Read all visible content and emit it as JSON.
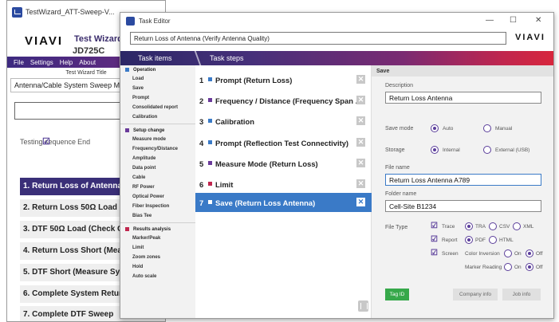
{
  "bg_window": {
    "title": "TestWizard_ATT-Sweep-V...",
    "minimize": "—",
    "brand_logo": "VIAVI",
    "app_title": "Test Wizard",
    "model": "JD725C",
    "menu": [
      "File",
      "Settings",
      "Help",
      "About"
    ],
    "wizard_title_label": "Test Wizard Title",
    "wizard_title_value": "Antenna/Cable System Sweep MOP",
    "sequence_header": "Testing sequence",
    "sequence_end_label": "End",
    "sequence": [
      "1. Return Loss of Antenna (...)",
      "2. Return Loss 50Ω Load (V...)",
      "3. DTF 50Ω Load (Check Ca...)",
      "4. Return Loss Short (Meas...)",
      "5. DTF Short (Measure Syst...)",
      "6. Complete System Return...",
      "7. Complete DTF Sweep"
    ]
  },
  "task_editor": {
    "title": "Task Editor",
    "window_controls": [
      "—",
      "☐",
      "✕"
    ],
    "task_name": "Return Loss of Antenna (Verify Antenna Quality)",
    "brand_logo": "VIAVI",
    "col_task_items": "Task items",
    "col_task_steps": "Task steps",
    "nav_groups": [
      {
        "label": "Operation",
        "color": "#3a7ac7",
        "items": [
          "Load",
          "Save",
          "Prompt",
          "Consolidated report",
          "Calibration"
        ]
      },
      {
        "label": "Setup change",
        "color": "#6a3a9a",
        "items": [
          "Measure mode",
          "Frequency/Distance",
          "Amplitude",
          "Data point",
          "Cable",
          "RF Power",
          "Optical Power",
          "Fiber Inspection",
          "Bias Tee"
        ]
      },
      {
        "label": "Results analysis",
        "color": "#c0264e",
        "items": [
          "Marker/Peak",
          "Limit",
          "Zoom zones",
          "Hold",
          "Auto scale"
        ]
      }
    ],
    "steps": [
      {
        "num": "1",
        "label": "Prompt (Return Loss)",
        "color": "#3a7ac7"
      },
      {
        "num": "2",
        "label": "Frequency / Distance (Frequency Span ...",
        "color": "#6a3a9a"
      },
      {
        "num": "3",
        "label": "Calibration",
        "color": "#3a7ac7"
      },
      {
        "num": "4",
        "label": "Prompt (Reflection Test Connectivity)",
        "color": "#3a7ac7"
      },
      {
        "num": "5",
        "label": "Measure Mode (Return Loss)",
        "color": "#6a3a9a"
      },
      {
        "num": "6",
        "label": "Limit",
        "color": "#c0264e"
      },
      {
        "num": "7",
        "label": "Save (Return Loss Antenna)",
        "color": "#ffffff"
      }
    ],
    "form": {
      "section": "Save",
      "description_label": "Description",
      "description_value": "Return Loss Antenna",
      "save_mode_label": "Save mode",
      "save_mode_auto": "Auto",
      "save_mode_manual": "Manual",
      "storage_label": "Storage",
      "storage_internal": "Internal",
      "storage_external": "External (USB)",
      "file_name_label": "File name",
      "file_name_value": "Return Loss Antenna A789",
      "folder_name_label": "Folder name",
      "folder_name_value": "Cell-Site B1234",
      "file_type_label": "File Type",
      "trace_label": "Trace",
      "tra": "TRA",
      "csv": "CSV",
      "xml": "XML",
      "report_label": "Report",
      "pdf": "PDF",
      "html": "HTML",
      "screen_label": "Screen",
      "color_inversion": "Color Inversion",
      "marker_reading": "Marker Reading",
      "on": "On",
      "off": "Off",
      "btn_tag_id": "Tag ID",
      "btn_company_info": "Company info",
      "btn_job_info": "Job info"
    }
  }
}
